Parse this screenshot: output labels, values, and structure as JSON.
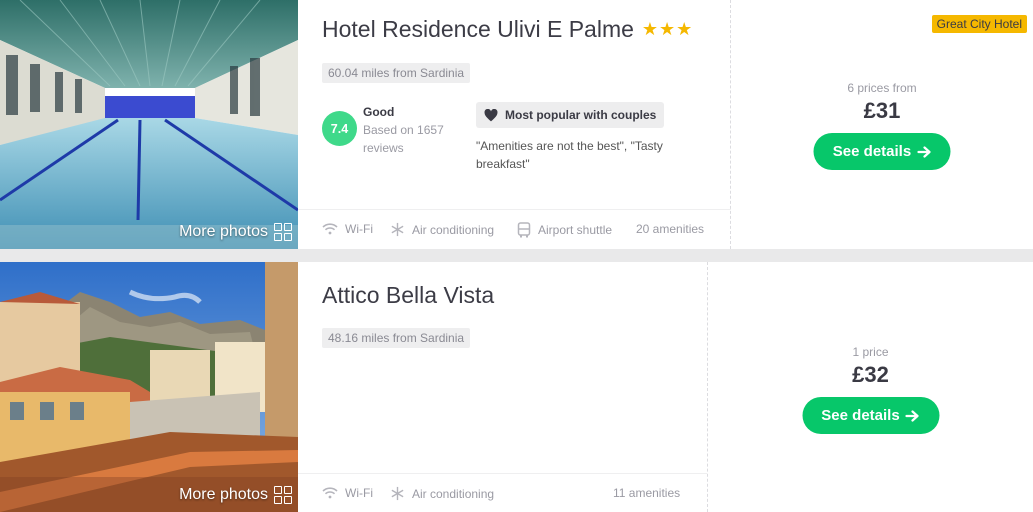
{
  "hotels": [
    {
      "name": "Hotel Residence Ulivi E Palme",
      "stars": "★★★",
      "distance": "60.04 miles from Sardinia",
      "more_photos": "More photos",
      "rating": {
        "score": "7.4",
        "word": "Good",
        "reviews": "Based on 1657 reviews"
      },
      "popular": "Most popular with couples",
      "quote": "\"Amenities are not the best\", \"Tasty breakfast\"",
      "amenities": [
        "Wi-Fi",
        "Air conditioning",
        "Airport shuttle"
      ],
      "amenities_count": "20 amenities",
      "badge": "Great City Hotel",
      "prices_from": "6 prices from",
      "price": "£31",
      "cta": "See details"
    },
    {
      "name": "Attico Bella Vista",
      "distance": "48.16 miles from Sardinia",
      "more_photos": "More photos",
      "amenities": [
        "Wi-Fi",
        "Air conditioning"
      ],
      "amenities_count": "11 amenities",
      "prices_from": "1 price",
      "price": "£32",
      "cta": "See details"
    }
  ],
  "icons": {
    "wifi": "wifi-icon",
    "ac": "snowflake-icon",
    "shuttle": "bus-icon",
    "heart": "heart-icon",
    "arrow": "arrow-right-icon",
    "grid": "grid-icon"
  },
  "colors": {
    "accent_green": "#07c76a",
    "score_green": "#3fd98a",
    "star_yellow": "#f5b800",
    "badge_yellow": "#f5b800"
  }
}
